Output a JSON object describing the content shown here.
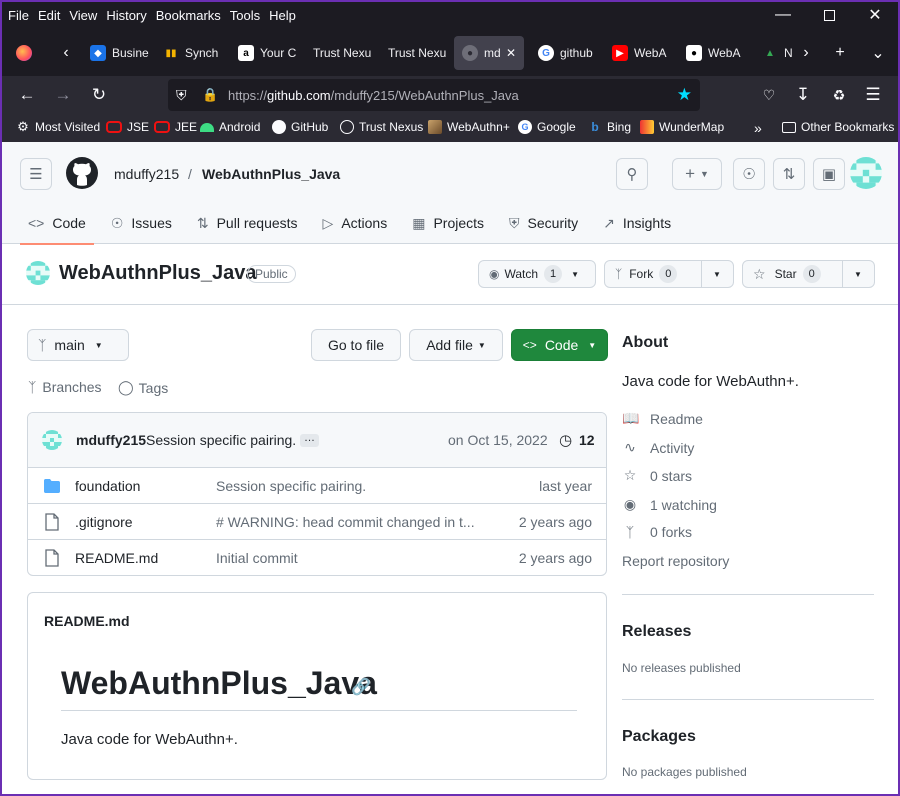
{
  "browser": {
    "menu": [
      "File",
      "Edit",
      "View",
      "History",
      "Bookmarks",
      "Tools",
      "Help"
    ],
    "tabs": [
      {
        "label": "Busine",
        "icon_color": "#1a73e8"
      },
      {
        "label": "Synch",
        "icon_color": "#f4b400"
      },
      {
        "label": "Your C",
        "icon_color": "#ffffff"
      },
      {
        "label": "Trust Nexu",
        "icon_color": "#2b2a33"
      },
      {
        "label": "Trust Nexu",
        "icon_color": "#2b2a33"
      },
      {
        "label": "md",
        "icon_color": "#42414d"
      },
      {
        "label": "github",
        "icon_color": "#ffffff"
      },
      {
        "label": "WebA",
        "icon_color": "#ff0000"
      },
      {
        "label": "WebA",
        "icon_color": "#000000"
      },
      {
        "label": "N",
        "icon_color": "#34a853"
      }
    ],
    "url_prefix": "https://",
    "url_host": "github.com",
    "url_path": "/mduffy215/WebAuthnPlus_Java",
    "bookmarks": [
      {
        "label": "Most Visited",
        "icon": "gear-icon"
      },
      {
        "label": "JSE",
        "icon": "oracle-icon"
      },
      {
        "label": "JEE",
        "icon": "oracle-icon"
      },
      {
        "label": "Android",
        "icon": "android-icon"
      },
      {
        "label": "GitHub",
        "icon": "github-icon"
      },
      {
        "label": "Trust Nexus",
        "icon": "globe-icon"
      },
      {
        "label": "WebAuthn+",
        "icon": "image-icon"
      },
      {
        "label": "Google",
        "icon": "google-icon"
      },
      {
        "label": "Bing",
        "icon": "bing-icon"
      },
      {
        "label": "WunderMap",
        "icon": "wunder-icon"
      }
    ],
    "other_bookmarks": "Other Bookmarks"
  },
  "header": {
    "owner": "mduffy215",
    "slash": "/",
    "repo": "WebAuthnPlus_Java"
  },
  "tabs": [
    {
      "label": "Code",
      "icon": "code-icon"
    },
    {
      "label": "Issues",
      "icon": "issue-icon"
    },
    {
      "label": "Pull requests",
      "icon": "pull-request-icon"
    },
    {
      "label": "Actions",
      "icon": "play-icon"
    },
    {
      "label": "Projects",
      "icon": "table-icon"
    },
    {
      "label": "Security",
      "icon": "shield-icon"
    },
    {
      "label": "Insights",
      "icon": "graph-icon"
    }
  ],
  "repo": {
    "name": "WebAuthnPlus_Java",
    "visibility": "Public",
    "watch_label": "Watch",
    "watch_count": "1",
    "fork_label": "Fork",
    "fork_count": "0",
    "star_label": "Star",
    "star_count": "0"
  },
  "toolbar": {
    "branch": "main",
    "go_to_file": "Go to file",
    "add_file": "Add file",
    "code": "Code",
    "branches": "Branches",
    "tags": "Tags"
  },
  "commit": {
    "author": "mduffy215",
    "message": "Session specific pairing.",
    "ellipsis": "…",
    "date": "on Oct 15, 2022",
    "count": "12"
  },
  "files": [
    {
      "name": "foundation",
      "type": "folder",
      "message": "Session specific pairing.",
      "date": "last year"
    },
    {
      "name": ".gitignore",
      "type": "file",
      "message": "# WARNING: head commit changed in t...",
      "date": "2 years ago"
    },
    {
      "name": "README.md",
      "type": "file",
      "message": "Initial commit",
      "date": "2 years ago"
    }
  ],
  "readme": {
    "filename": "README.md",
    "title": "WebAuthnPlus_Java",
    "body": "Java code for WebAuthn+."
  },
  "about": {
    "heading": "About",
    "description": "Java code for WebAuthn+.",
    "items": [
      {
        "label": "Readme",
        "icon": "book-icon"
      },
      {
        "label": "Activity",
        "icon": "pulse-icon"
      },
      {
        "label": "0 stars",
        "icon": "star-icon"
      },
      {
        "label": "1 watching",
        "icon": "eye-icon"
      },
      {
        "label": "0 forks",
        "icon": "fork-icon"
      }
    ],
    "report": "Report repository",
    "releases_heading": "Releases",
    "releases_text": "No releases published",
    "packages_heading": "Packages",
    "packages_text": "No packages published"
  },
  "colors": {
    "accent_underline": "#fd8c73",
    "code_button": "#1f883d",
    "folder": "#54aeff",
    "identicon": "#6ee0d4"
  }
}
